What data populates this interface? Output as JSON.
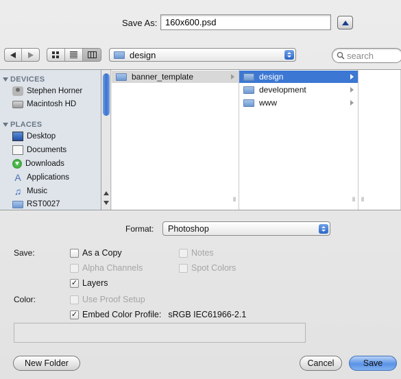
{
  "save_as": {
    "label": "Save As:",
    "filename": "160x600.psd"
  },
  "path_popup": {
    "current": "design"
  },
  "search": {
    "placeholder": "search"
  },
  "sidebar": {
    "devices_header": "DEVICES",
    "devices": [
      {
        "label": "Stephen Horner",
        "icon": "user-home-icon"
      },
      {
        "label": "Macintosh HD",
        "icon": "hard-drive-icon"
      }
    ],
    "places_header": "PLACES",
    "places": [
      {
        "label": "Desktop",
        "icon": "desktop-icon"
      },
      {
        "label": "Documents",
        "icon": "documents-icon"
      },
      {
        "label": "Downloads",
        "icon": "downloads-icon"
      },
      {
        "label": "Applications",
        "icon": "applications-icon"
      },
      {
        "label": "Music",
        "icon": "music-icon"
      },
      {
        "label": "RST0027",
        "icon": "folder-icon"
      }
    ]
  },
  "columns": {
    "col1": [
      {
        "label": "banner_template"
      }
    ],
    "col2": [
      {
        "label": "design",
        "selected": true
      },
      {
        "label": "development"
      },
      {
        "label": "www"
      }
    ]
  },
  "format": {
    "label": "Format:",
    "value": "Photoshop"
  },
  "save_options": {
    "label": "Save:",
    "as_a_copy": "As a Copy",
    "notes": "Notes",
    "alpha_channels": "Alpha Channels",
    "spot_colors": "Spot Colors",
    "layers": "Layers"
  },
  "color_options": {
    "label": "Color:",
    "use_proof_setup": "Use Proof Setup",
    "embed_profile": "Embed Color Profile:",
    "profile_name": "sRGB IEC61966-2.1"
  },
  "buttons": {
    "new_folder": "New Folder",
    "cancel": "Cancel",
    "save": "Save"
  },
  "colors": {
    "selection": "#3c78d3",
    "default_button": "#5b93e6"
  }
}
